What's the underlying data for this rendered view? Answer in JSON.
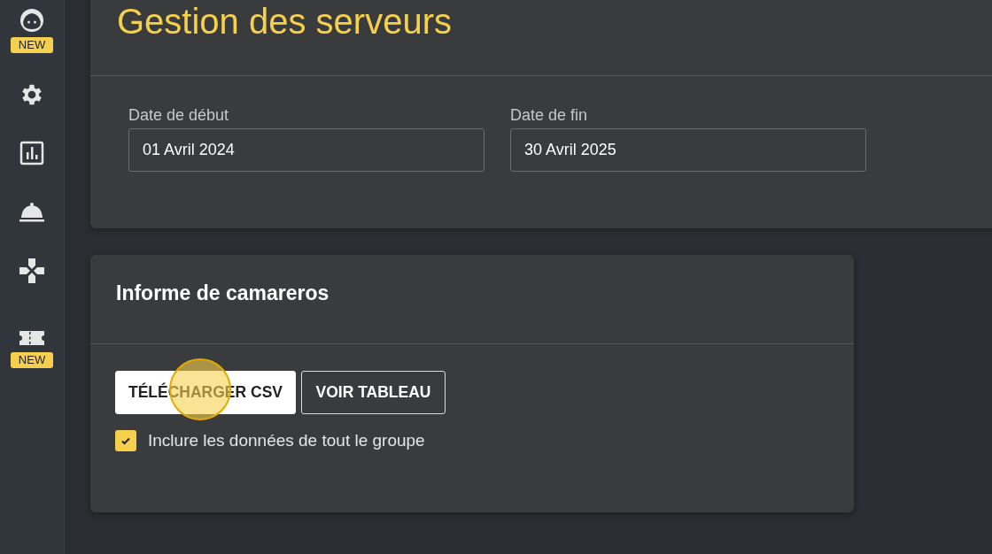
{
  "sidebar": {
    "items": [
      {
        "kind": "face",
        "badge": "NEW"
      },
      {
        "kind": "gear"
      },
      {
        "kind": "chart"
      },
      {
        "kind": "bell"
      },
      {
        "kind": "dpad"
      },
      {
        "kind": "ticket",
        "badge": "NEW"
      }
    ]
  },
  "header": {
    "title": "Gestion des serveurs",
    "fields": [
      {
        "label": "Date de début",
        "value": "01 Avril 2024"
      },
      {
        "label": "Date de fin",
        "value": "30 Avril 2025"
      }
    ]
  },
  "report": {
    "title": "Informe de camareros",
    "buttons": [
      {
        "label": "TÉLÉCHARGER CSV",
        "kind": "filled"
      },
      {
        "label": "VOIR TABLEAU",
        "kind": "outlined"
      }
    ],
    "checkbox": {
      "label": "Inclure les données de tout le groupe",
      "checked": true
    }
  },
  "click_highlight": {
    "kind": "click"
  }
}
